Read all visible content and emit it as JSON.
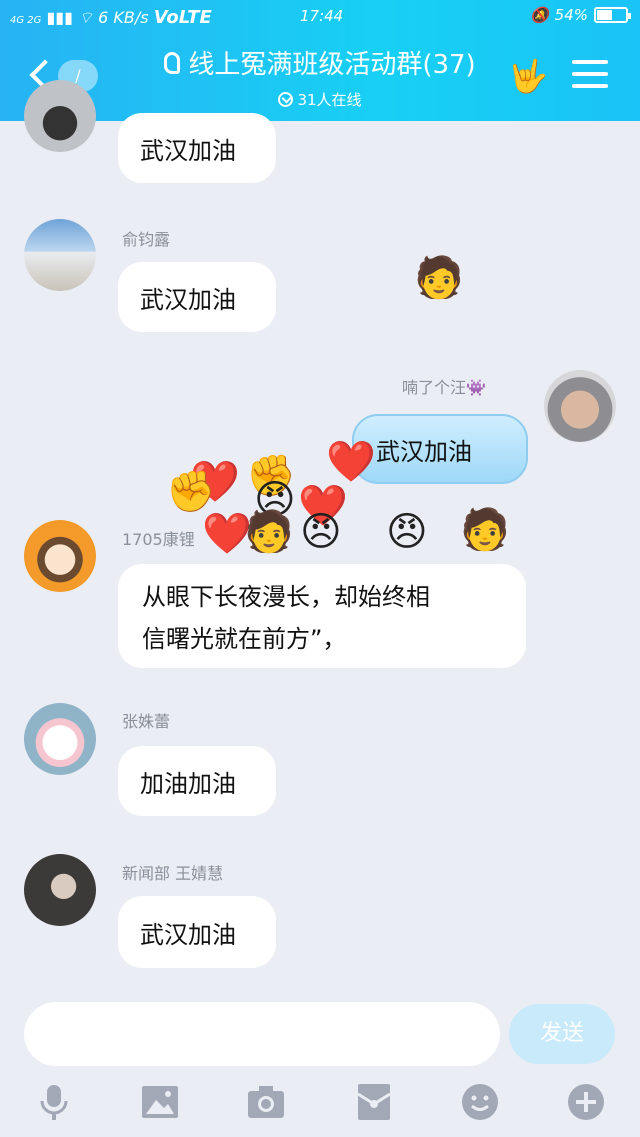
{
  "status": {
    "network": "4G 2G",
    "speed": "6 KB/s",
    "volte": "VoLTE",
    "time": "17:44",
    "battery": "54%",
    "battery_level": 0.54
  },
  "header": {
    "unread_count": "/",
    "title": "线上冤满班级活动群(37)",
    "online": "31人在线"
  },
  "messages": [
    {
      "sender": "",
      "text": "武汉加油"
    },
    {
      "sender": "俞钧露",
      "text": "武汉加油"
    },
    {
      "sender": "喃了个汪👾",
      "text": "武汉加油",
      "mine": true
    },
    {
      "sender": "1705康锂",
      "text_line1": "从眼下长夜漫长，却始终相",
      "text_line2": "信曙光就在前方”，"
    },
    {
      "sender": "张姝蕾",
      "text": "加油加油"
    },
    {
      "sender": "新闻部 王婧慧",
      "text": "武汉加油"
    }
  ],
  "input": {
    "placeholder": "",
    "send_label": "发送"
  },
  "toolbar": {
    "items": [
      "mic-icon",
      "image-icon",
      "camera-icon",
      "red-packet-icon",
      "emoji-icon",
      "plus-icon"
    ]
  },
  "colors": {
    "header_gradient_start": "#27b3f4",
    "header_gradient_end": "#1ac3f7",
    "chat_bg": "#eaedf4",
    "mine_bubble": "#bde6fb",
    "send_button": "#c9eafa"
  }
}
